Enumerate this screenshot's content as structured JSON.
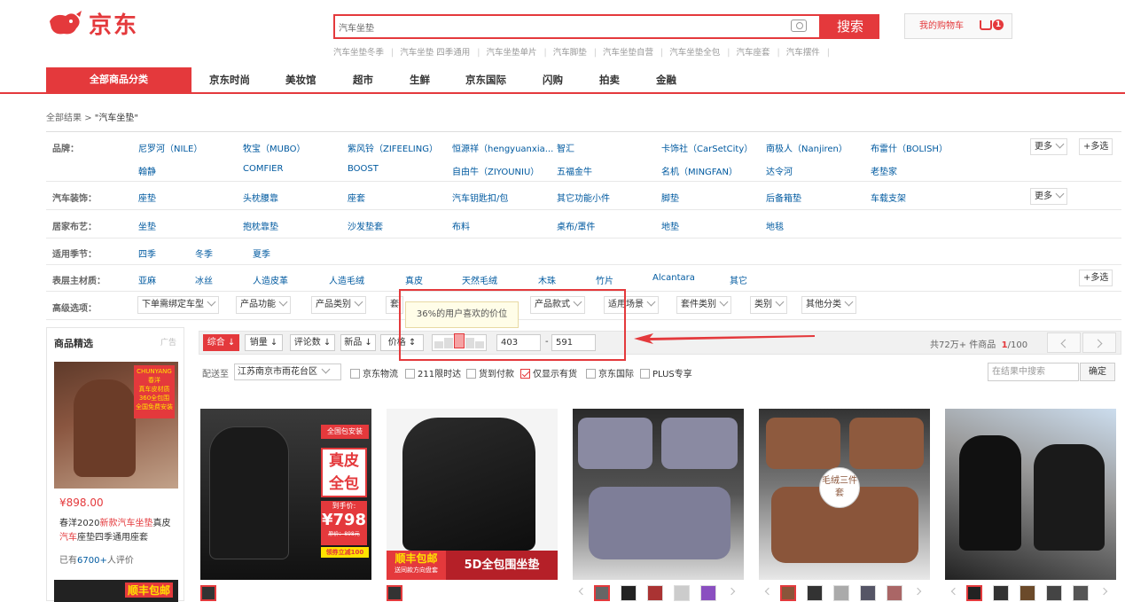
{
  "logo": {
    "text": "京东"
  },
  "search": {
    "value": "汽车坐垫",
    "button": "搜索"
  },
  "cart": {
    "label": "我的购物车",
    "count": "1"
  },
  "hotwords": [
    "汽车坐垫冬季",
    "汽车坐垫 四季通用",
    "汽车坐垫单片",
    "汽车脚垫",
    "汽车坐垫自营",
    "汽车坐垫全包",
    "汽车座套",
    "汽车摆件"
  ],
  "nav": {
    "all": "全部商品分类",
    "items": [
      "京东时尚",
      "美妆馆",
      "超市",
      "生鲜",
      "京东国际",
      "闪购",
      "拍卖",
      "金融"
    ]
  },
  "breadcrumb": {
    "root": "全部结果",
    "sep": ">",
    "query": "\"汽车坐垫\""
  },
  "filters": {
    "brand": {
      "label": "品牌：",
      "row1": [
        "尼罗河（NILE）",
        "牧宝（MUBO）",
        "紫风铃（ZIFEELING）",
        "恒源祥（hengyuanxia...",
        "智汇",
        "卡饰社（CarSetCity）",
        "南极人（Nanjiren）",
        "布雷什（BOLISH）"
      ],
      "row2": [
        "翰静",
        "COMFIER",
        "BOOST",
        "自由牛（ZIYOUNIU）",
        "五福金牛",
        "名机（MINGFAN）",
        "达令河",
        "老垫家"
      ],
      "more": "更多",
      "multi": "+多选"
    },
    "decor": {
      "label": "汽车装饰：",
      "items": [
        "座垫",
        "头枕腰靠",
        "座套",
        "汽车钥匙扣/包",
        "其它功能小件",
        "脚垫",
        "后备箱垫",
        "车载支架"
      ],
      "more": "更多"
    },
    "home": {
      "label": "居家布艺：",
      "items": [
        "坐垫",
        "抱枕靠垫",
        "沙发垫套",
        "布料",
        "桌布/罩件",
        "地垫",
        "地毯"
      ]
    },
    "season": {
      "label": "适用季节：",
      "items": [
        "四季",
        "冬季",
        "夏季"
      ]
    },
    "material": {
      "label": "表层主材质：",
      "items": [
        "亚麻",
        "冰丝",
        "人造皮革",
        "人造毛绒",
        "真皮",
        "天然毛绒",
        "木珠",
        "竹片",
        "Alcantara",
        "其它"
      ],
      "multi": "+多选"
    },
    "advanced": {
      "label": "高级选项：",
      "items": [
        "下单需绑定车型",
        "产品功能",
        "产品类别",
        "套",
        "产品款式",
        "适用场景",
        "套件类别",
        "类别",
        "其他分类"
      ]
    }
  },
  "tooltip": "36%的用户喜欢的价位",
  "sort": {
    "items": [
      "综合",
      "销量",
      "评论数",
      "新品",
      "价格"
    ],
    "price_min": "403",
    "price_max": "591",
    "dash": "-",
    "total": "共72万+ 件商品",
    "page": "1",
    "pages": "/100"
  },
  "location": {
    "label": "配送至",
    "value": "江苏南京市雨花台区",
    "checks": [
      {
        "label": "京东物流",
        "checked": false
      },
      {
        "label": "211限时达",
        "checked": false
      },
      {
        "label": "货到付款",
        "checked": false
      },
      {
        "label": "仅显示有货",
        "checked": true
      },
      {
        "label": "京东国际",
        "checked": false
      },
      {
        "label": "PLUS专享",
        "checked": false
      }
    ],
    "insearch": "在结果中搜索",
    "confirm": "确定"
  },
  "sidebar": {
    "title": "商品精选",
    "ad": "广告",
    "price": "¥898.00",
    "desc_pre": "春洋2020",
    "desc_hl": "新款汽车坐垫",
    "desc_mid": "真皮",
    "desc_hl2": "汽车",
    "desc_post": "座垫四季通用座套",
    "comments_pre": "已有",
    "comments_count": "6700+",
    "comments_post": "人评价",
    "tag_lines": [
      "CHUNYANG春洋",
      "真车皮材质",
      "360全包围",
      "全国免费安装"
    ],
    "img2_text": "顺丰包邮"
  },
  "products": [
    {
      "badge1": "全国包安装",
      "badge2": "真皮全包",
      "price_label": "到手价:",
      "price": "¥798",
      "old_price": "原价：898元",
      "coupon": "领券立减100"
    },
    {
      "banner1": "顺丰包邮",
      "banner1_sub": "送同款方向盘套",
      "banner2": "5D全包围坐垫"
    },
    {},
    {
      "badge": "毛绒三件套"
    },
    {}
  ],
  "colors": {
    "accent": "#e4393c",
    "link": "#005aa0"
  }
}
